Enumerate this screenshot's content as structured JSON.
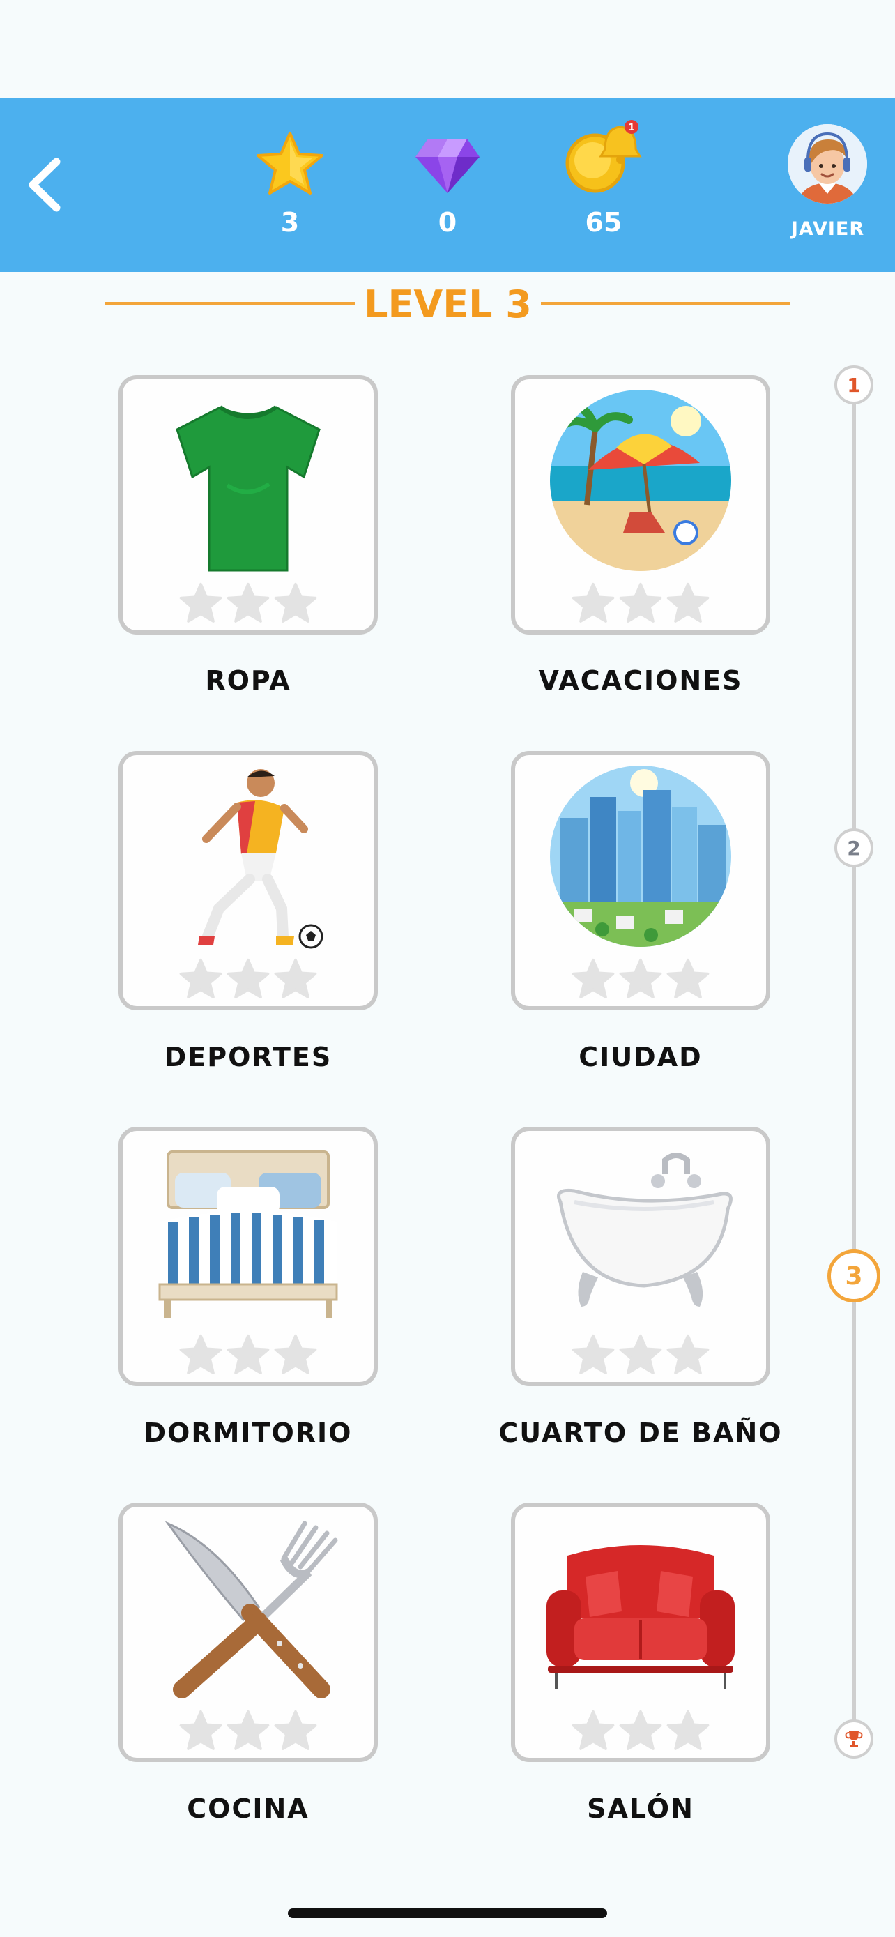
{
  "header": {
    "back_icon": "chevron-left-icon",
    "stats": [
      {
        "name": "stars",
        "icon": "star-icon",
        "value": "3"
      },
      {
        "name": "gems",
        "icon": "gem-icon",
        "value": "0"
      },
      {
        "name": "coins",
        "icon": "coin-bell-icon",
        "value": "65",
        "notification_badge": "1"
      }
    ],
    "user": {
      "name": "JAVIER",
      "avatar_icon": "avatar-icon"
    }
  },
  "level": {
    "title": "LEVEL 3"
  },
  "categories": [
    {
      "label": "ROPA",
      "icon": "tshirt-icon",
      "stars_earned": 0,
      "stars_total": 3
    },
    {
      "label": "VACACIONES",
      "icon": "beach-icon",
      "stars_earned": 0,
      "stars_total": 3
    },
    {
      "label": "DEPORTES",
      "icon": "soccer-player-icon",
      "stars_earned": 0,
      "stars_total": 3
    },
    {
      "label": "CIUDAD",
      "icon": "city-icon",
      "stars_earned": 0,
      "stars_total": 3
    },
    {
      "label": "DORMITORIO",
      "icon": "bed-icon",
      "stars_earned": 0,
      "stars_total": 3
    },
    {
      "label": "CUARTO DE BAÑO",
      "icon": "bathtub-icon",
      "stars_earned": 0,
      "stars_total": 3
    },
    {
      "label": "COCINA",
      "icon": "knife-fork-icon",
      "stars_earned": 0,
      "stars_total": 3
    },
    {
      "label": "SALÓN",
      "icon": "sofa-icon",
      "stars_earned": 0,
      "stars_total": 3
    }
  ],
  "progress": {
    "nodes": [
      {
        "label": "1",
        "state": "done"
      },
      {
        "label": "2",
        "state": "locked"
      },
      {
        "label": "3",
        "state": "current"
      },
      {
        "label": "",
        "icon": "trophy-icon",
        "state": "locked"
      }
    ]
  },
  "colors": {
    "header_bg": "#4cb0ee",
    "accent_orange": "#f39a1f",
    "card_border": "#c9c9c9",
    "star_empty": "#e3e3e3"
  }
}
